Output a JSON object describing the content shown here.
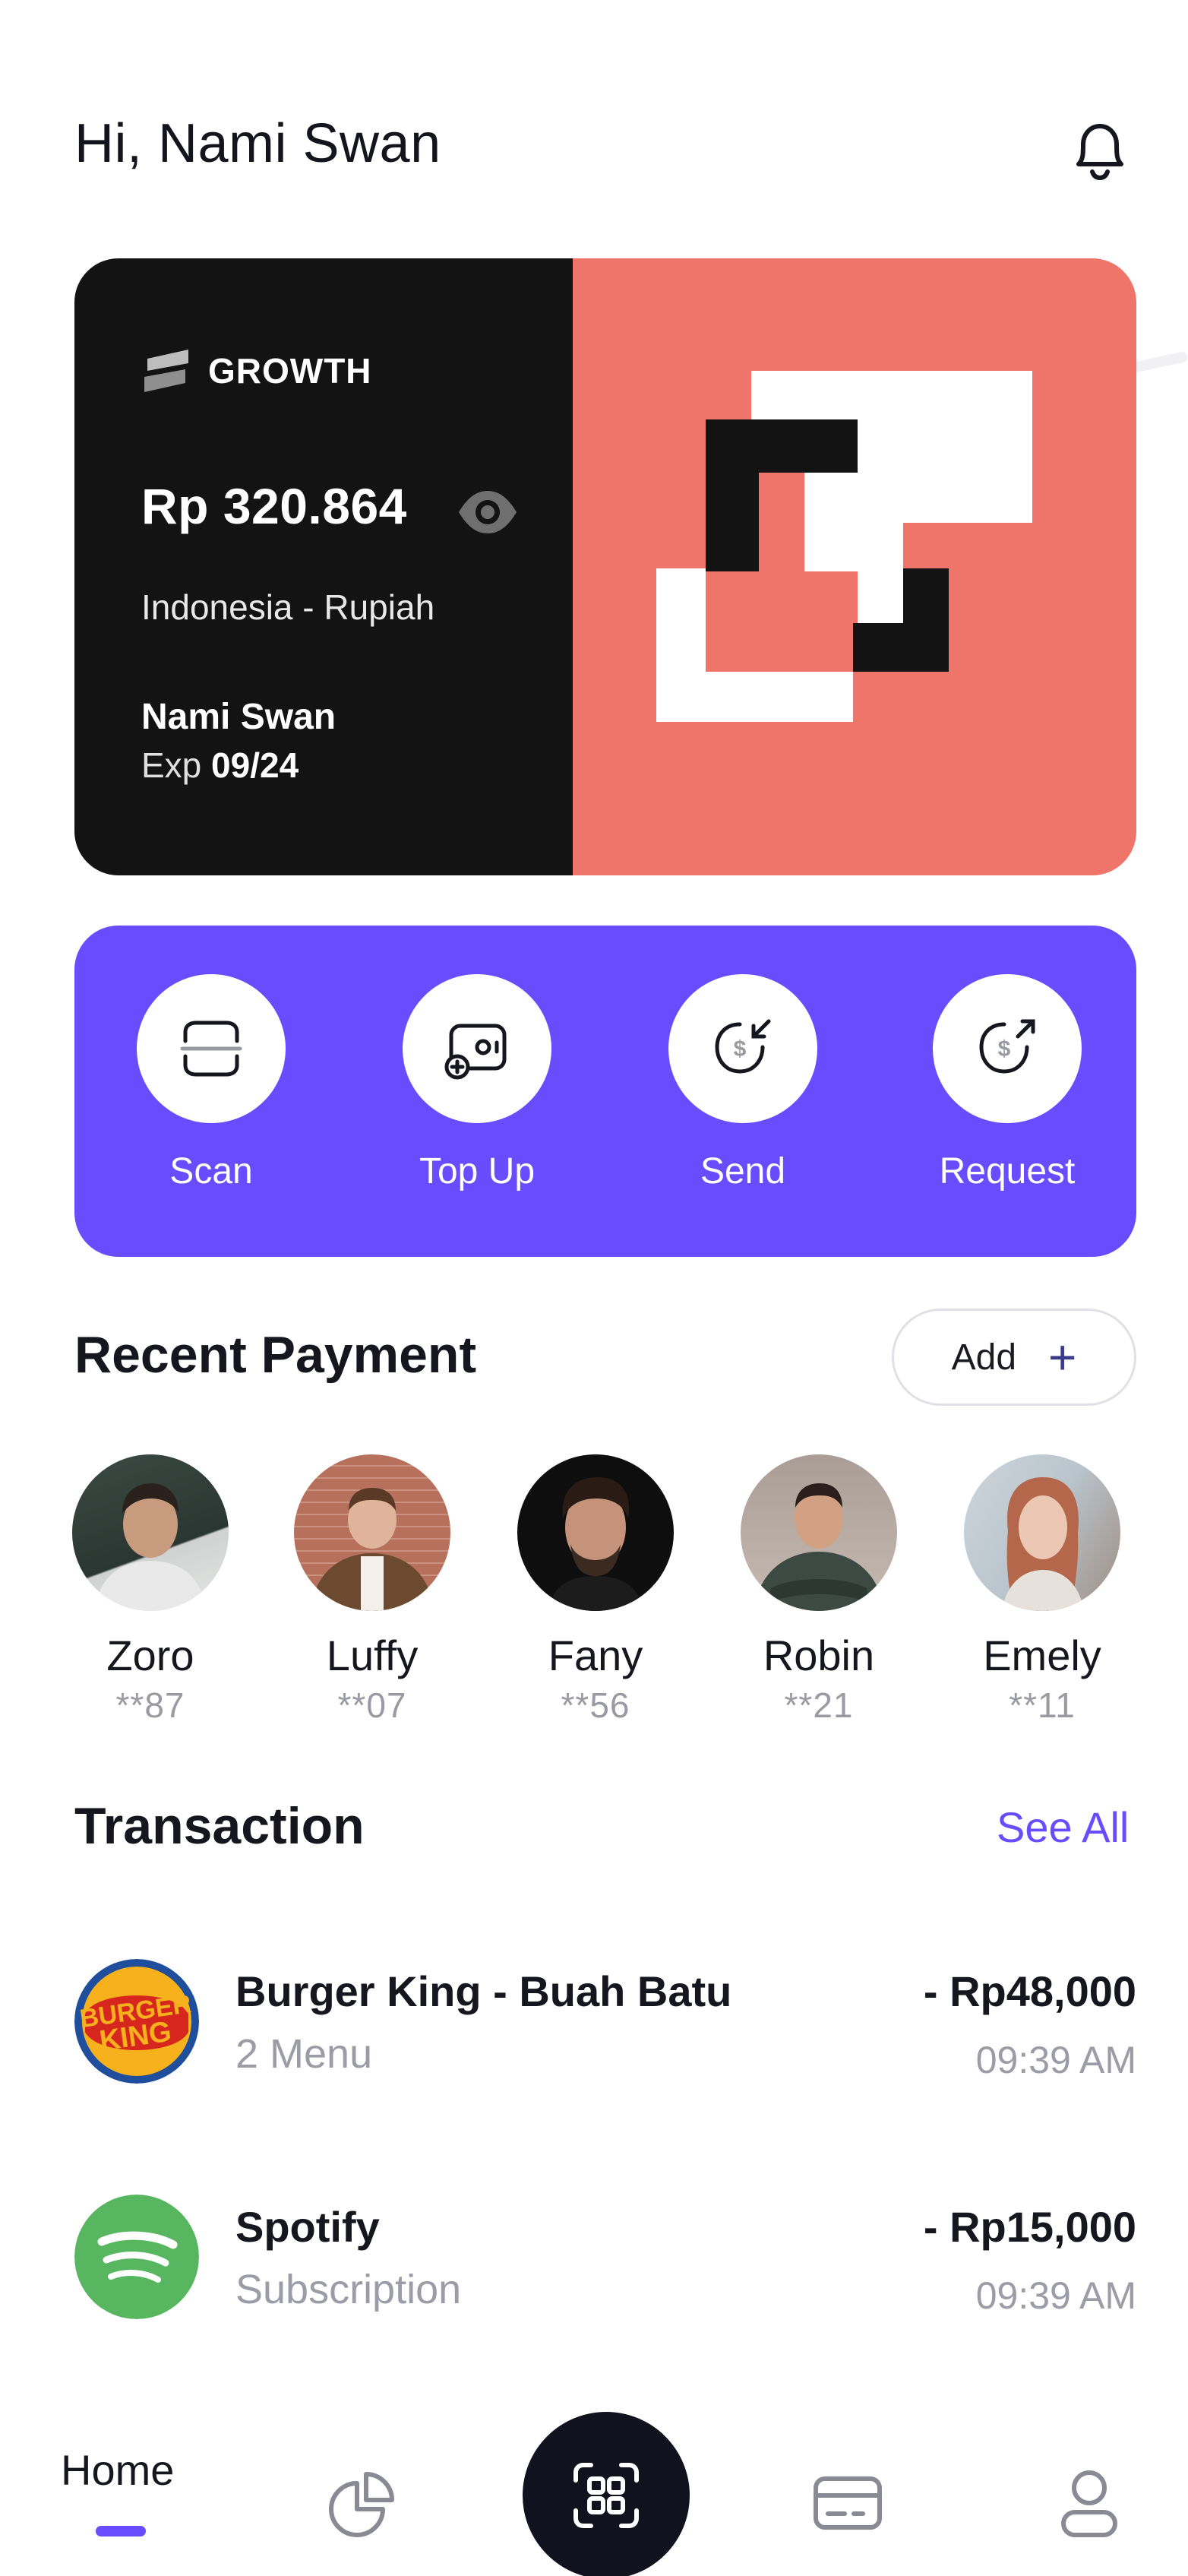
{
  "header": {
    "greeting": "Hi, Nami Swan",
    "notification_icon": "bell-icon"
  },
  "card": {
    "brand": "GROWTH",
    "balance": "Rp 320.864",
    "currency": "Indonesia - Rupiah",
    "holder": "Nami Swan",
    "exp_label": "Exp",
    "exp_value": "09/24",
    "colors": {
      "left": "#131313",
      "right": "#ef756b"
    }
  },
  "actions": [
    {
      "label": "Scan",
      "icon": "scan-icon"
    },
    {
      "label": "Top Up",
      "icon": "top-up-icon"
    },
    {
      "label": "Send",
      "icon": "send-money-icon"
    },
    {
      "label": "Request",
      "icon": "request-money-icon"
    }
  ],
  "recent": {
    "title": "Recent Payment",
    "add_label": "Add",
    "contacts": [
      {
        "name": "Zoro",
        "number": "**87"
      },
      {
        "name": "Luffy",
        "number": "**07"
      },
      {
        "name": "Fany",
        "number": "**56"
      },
      {
        "name": "Robin",
        "number": "**21"
      },
      {
        "name": "Emely",
        "number": "**11"
      }
    ]
  },
  "transactions": {
    "title": "Transaction",
    "see_all": "See All",
    "items": [
      {
        "name": "Burger King - Buah Batu",
        "sub": "2 Menu",
        "amount": "- Rp48,000",
        "time": "09:39 AM",
        "logo": "burger-king-logo"
      },
      {
        "name": "Spotify",
        "sub": "Subscription",
        "amount": "- Rp15,000",
        "time": "09:39 AM",
        "logo": "spotify-logo"
      }
    ]
  },
  "nav": {
    "home_label": "Home",
    "accent": "#6a4cff"
  }
}
